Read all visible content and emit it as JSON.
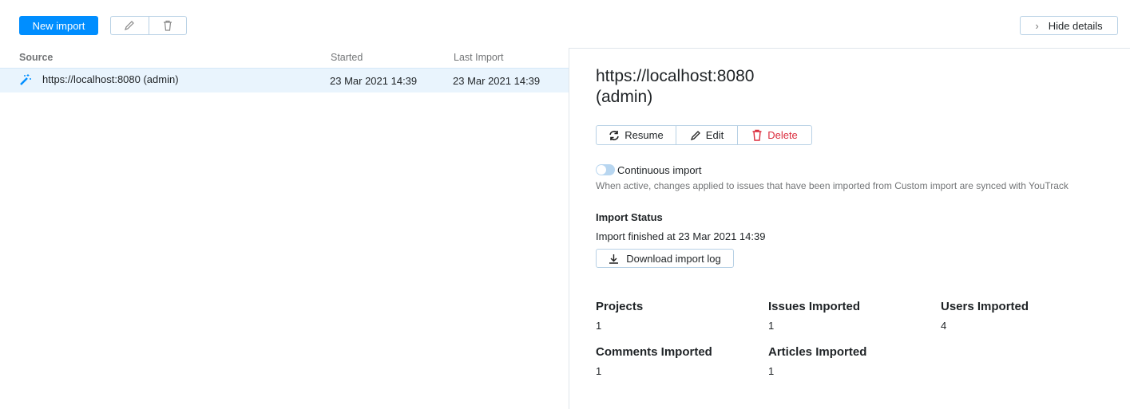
{
  "toolbar": {
    "new_import": "New import",
    "hide_details": "Hide details"
  },
  "table": {
    "headers": [
      "Source",
      "Started",
      "Last Import"
    ],
    "rows": [
      {
        "source": "https://localhost:8080 (admin)",
        "started": "23 Mar 2021 14:39",
        "last_import": "23 Mar 2021 14:39"
      }
    ]
  },
  "detail": {
    "title_line1": "https://localhost:8080",
    "title_line2": "(admin)",
    "actions": {
      "resume": "Resume",
      "edit": "Edit",
      "delete": "Delete"
    },
    "continuous_label": "Continuous import",
    "continuous_on": false,
    "continuous_hint": "When active, changes applied to issues that have been imported from Custom import are synced with YouTrack",
    "status_heading": "Import Status",
    "status_text": "Import finished at 23 Mar 2021 14:39",
    "download_log": "Download import log",
    "stats": [
      {
        "label": "Projects",
        "value": "1"
      },
      {
        "label": "Issues Imported",
        "value": "1"
      },
      {
        "label": "Users Imported",
        "value": "4"
      },
      {
        "label": "Comments Imported",
        "value": "1"
      },
      {
        "label": "Articles Imported",
        "value": "1"
      }
    ]
  },
  "colors": {
    "accent": "#008eff",
    "danger": "#db2d3e"
  }
}
